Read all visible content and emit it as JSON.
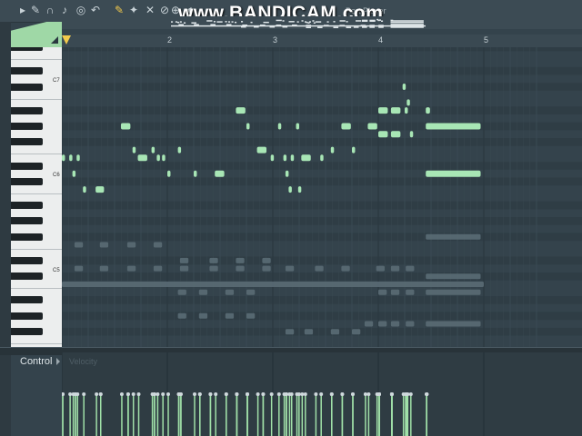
{
  "watermark": {
    "text": "www.BANDICAM.com",
    "subtitle": "Port Player"
  },
  "timeline": {
    "bars": [
      "2",
      "3",
      "4",
      "5"
    ]
  },
  "keyboard": {
    "octaves": [
      "C7",
      "C6",
      "C5"
    ]
  },
  "event_editor": {
    "label": "Control",
    "sublabel": "Velocity"
  },
  "toolbar": {
    "icons": [
      "arrow-right-icon",
      "wrench-icon",
      "magnet-icon",
      "note-icon",
      "loop-icon",
      "undo-icon",
      "pencil-icon",
      "brush-icon",
      "mute-icon",
      "delete-icon",
      "zoom-icon",
      "speaker-icon"
    ]
  },
  "colors": {
    "note_active": "#a8e6b5",
    "note_ghost": "#5a6c74",
    "grid_bg": "#34434c",
    "velocity": "#a0e0a8"
  },
  "notes": [
    {
      "bar": 1.0,
      "len": 0.03,
      "pitch": 88
    },
    {
      "bar": 1.07,
      "len": 0.03,
      "pitch": 88
    },
    {
      "bar": 1.14,
      "len": 0.03,
      "pitch": 88
    },
    {
      "bar": 1.1,
      "len": 0.03,
      "pitch": 86
    },
    {
      "bar": 1.2,
      "len": 0.03,
      "pitch": 84
    },
    {
      "bar": 1.32,
      "len": 0.08,
      "pitch": 84
    },
    {
      "bar": 1.56,
      "len": 0.09,
      "pitch": 92
    },
    {
      "bar": 1.67,
      "len": 0.03,
      "pitch": 89
    },
    {
      "bar": 1.72,
      "len": 0.09,
      "pitch": 88
    },
    {
      "bar": 1.85,
      "len": 0.03,
      "pitch": 89
    },
    {
      "bar": 1.9,
      "len": 0.03,
      "pitch": 88
    },
    {
      "bar": 1.95,
      "len": 0.03,
      "pitch": 88
    },
    {
      "bar": 2.0,
      "len": 0.03,
      "pitch": 86
    },
    {
      "bar": 2.1,
      "len": 0.03,
      "pitch": 89
    },
    {
      "bar": 2.25,
      "len": 0.03,
      "pitch": 86
    },
    {
      "bar": 2.45,
      "len": 0.09,
      "pitch": 86
    },
    {
      "bar": 2.65,
      "len": 0.09,
      "pitch": 94
    },
    {
      "bar": 2.75,
      "len": 0.03,
      "pitch": 92
    },
    {
      "bar": 2.85,
      "len": 0.09,
      "pitch": 89
    },
    {
      "bar": 2.98,
      "len": 0.03,
      "pitch": 88
    },
    {
      "bar": 3.05,
      "len": 0.03,
      "pitch": 92
    },
    {
      "bar": 3.1,
      "len": 0.03,
      "pitch": 88
    },
    {
      "bar": 3.12,
      "len": 0.03,
      "pitch": 86
    },
    {
      "bar": 3.15,
      "len": 0.03,
      "pitch": 84
    },
    {
      "bar": 3.17,
      "len": 0.03,
      "pitch": 88
    },
    {
      "bar": 3.22,
      "len": 0.03,
      "pitch": 92
    },
    {
      "bar": 3.24,
      "len": 0.03,
      "pitch": 84
    },
    {
      "bar": 3.27,
      "len": 0.09,
      "pitch": 88
    },
    {
      "bar": 3.45,
      "len": 0.03,
      "pitch": 88
    },
    {
      "bar": 3.55,
      "len": 0.03,
      "pitch": 89
    },
    {
      "bar": 3.65,
      "len": 0.09,
      "pitch": 92
    },
    {
      "bar": 3.75,
      "len": 0.03,
      "pitch": 89
    },
    {
      "bar": 3.9,
      "len": 0.09,
      "pitch": 92
    },
    {
      "bar": 4.0,
      "len": 0.09,
      "pitch": 94
    },
    {
      "bar": 4.0,
      "len": 0.09,
      "pitch": 91
    },
    {
      "bar": 4.12,
      "len": 0.09,
      "pitch": 94
    },
    {
      "bar": 4.12,
      "len": 0.09,
      "pitch": 91
    },
    {
      "bar": 4.23,
      "len": 0.03,
      "pitch": 97
    },
    {
      "bar": 4.27,
      "len": 0.03,
      "pitch": 95
    },
    {
      "bar": 4.25,
      "len": 0.03,
      "pitch": 94
    },
    {
      "bar": 4.3,
      "len": 0.03,
      "pitch": 91
    },
    {
      "bar": 4.45,
      "len": 0.04,
      "pitch": 94
    },
    {
      "bar": 4.45,
      "len": 0.52,
      "pitch": 92
    },
    {
      "bar": 4.45,
      "len": 0.52,
      "pitch": 86
    }
  ],
  "ghost_notes": [
    {
      "bar": 1.12,
      "len": 0.08,
      "pitch": 77
    },
    {
      "bar": 1.36,
      "len": 0.08,
      "pitch": 77
    },
    {
      "bar": 1.62,
      "len": 0.08,
      "pitch": 77
    },
    {
      "bar": 1.87,
      "len": 0.08,
      "pitch": 77
    },
    {
      "bar": 1.12,
      "len": 0.08,
      "pitch": 74
    },
    {
      "bar": 1.36,
      "len": 0.08,
      "pitch": 74
    },
    {
      "bar": 1.62,
      "len": 0.08,
      "pitch": 74
    },
    {
      "bar": 1.87,
      "len": 0.08,
      "pitch": 74
    },
    {
      "bar": 2.12,
      "len": 0.08,
      "pitch": 75
    },
    {
      "bar": 2.4,
      "len": 0.08,
      "pitch": 75
    },
    {
      "bar": 2.65,
      "len": 0.08,
      "pitch": 75
    },
    {
      "bar": 2.9,
      "len": 0.08,
      "pitch": 75
    },
    {
      "bar": 2.12,
      "len": 0.08,
      "pitch": 74
    },
    {
      "bar": 2.4,
      "len": 0.08,
      "pitch": 74
    },
    {
      "bar": 2.65,
      "len": 0.08,
      "pitch": 74
    },
    {
      "bar": 2.9,
      "len": 0.08,
      "pitch": 74
    },
    {
      "bar": 3.12,
      "len": 0.08,
      "pitch": 74
    },
    {
      "bar": 3.4,
      "len": 0.08,
      "pitch": 74
    },
    {
      "bar": 3.65,
      "len": 0.08,
      "pitch": 74
    },
    {
      "bar": 3.98,
      "len": 0.08,
      "pitch": 74
    },
    {
      "bar": 4.12,
      "len": 0.08,
      "pitch": 74
    },
    {
      "bar": 4.26,
      "len": 0.08,
      "pitch": 74
    },
    {
      "bar": 4.45,
      "len": 0.52,
      "pitch": 78
    },
    {
      "bar": 4.45,
      "len": 0.52,
      "pitch": 73
    },
    {
      "bar": 1.0,
      "len": 4.0,
      "pitch": 72
    },
    {
      "bar": 2.1,
      "len": 0.08,
      "pitch": 68
    },
    {
      "bar": 2.3,
      "len": 0.08,
      "pitch": 68
    },
    {
      "bar": 2.55,
      "len": 0.08,
      "pitch": 68
    },
    {
      "bar": 2.75,
      "len": 0.08,
      "pitch": 68
    },
    {
      "bar": 2.1,
      "len": 0.08,
      "pitch": 71
    },
    {
      "bar": 2.3,
      "len": 0.08,
      "pitch": 71
    },
    {
      "bar": 2.55,
      "len": 0.08,
      "pitch": 71
    },
    {
      "bar": 2.75,
      "len": 0.08,
      "pitch": 71
    },
    {
      "bar": 4.0,
      "len": 0.08,
      "pitch": 71
    },
    {
      "bar": 4.12,
      "len": 0.08,
      "pitch": 71
    },
    {
      "bar": 4.26,
      "len": 0.08,
      "pitch": 71
    },
    {
      "bar": 4.45,
      "len": 0.52,
      "pitch": 71
    },
    {
      "bar": 3.12,
      "len": 0.08,
      "pitch": 66
    },
    {
      "bar": 3.3,
      "len": 0.08,
      "pitch": 66
    },
    {
      "bar": 3.55,
      "len": 0.08,
      "pitch": 66
    },
    {
      "bar": 3.75,
      "len": 0.08,
      "pitch": 66
    },
    {
      "bar": 3.87,
      "len": 0.08,
      "pitch": 67
    },
    {
      "bar": 4.0,
      "len": 0.08,
      "pitch": 67
    },
    {
      "bar": 4.12,
      "len": 0.08,
      "pitch": 67
    },
    {
      "bar": 4.26,
      "len": 0.08,
      "pitch": 67
    },
    {
      "bar": 4.45,
      "len": 0.52,
      "pitch": 67
    }
  ]
}
